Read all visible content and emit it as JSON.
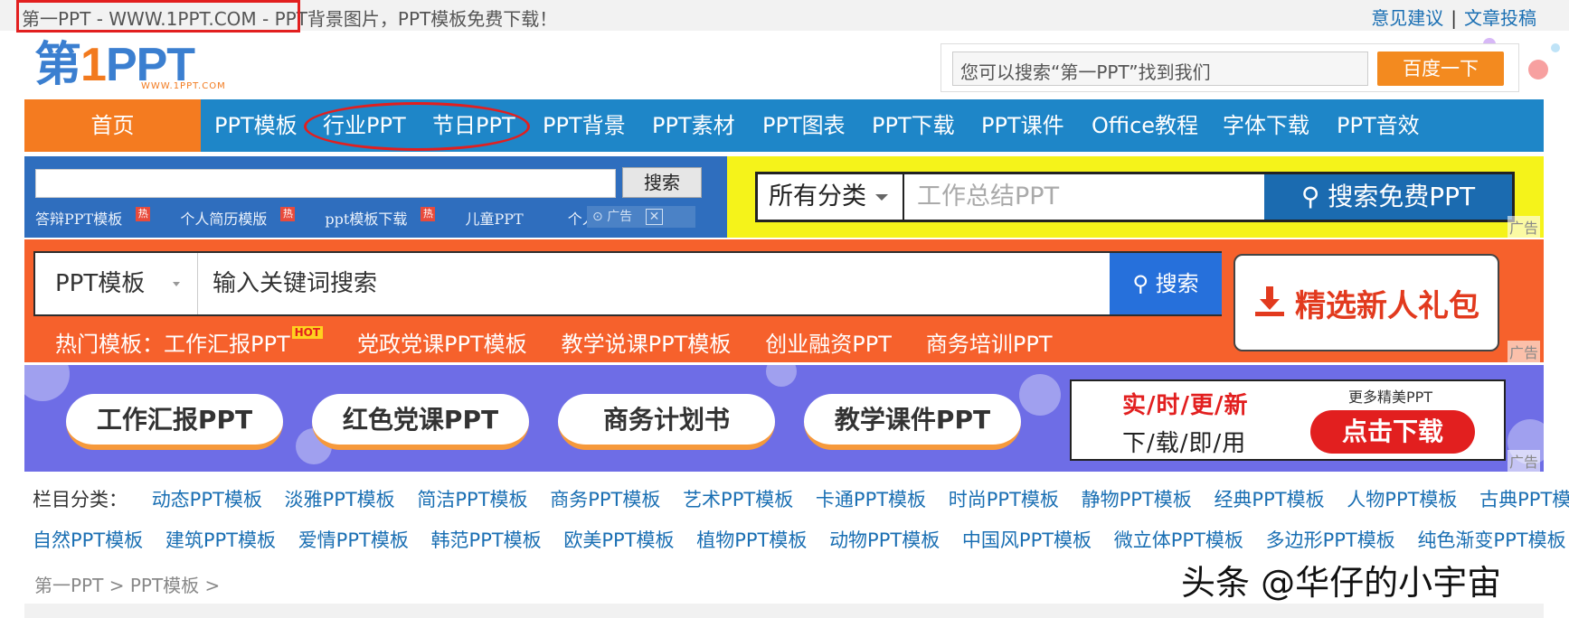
{
  "topbar": {
    "site_title": "第一PPT - WWW.1PPT.COM - PPT背景图片，PPT模板免费下载！",
    "link_feedback": "意见建议",
    "separator": "|",
    "link_submit": "文章投稿"
  },
  "logo": {
    "main_prefix": "第",
    "main_one": "1",
    "main_suffix": "PPT",
    "sub": "WWW.1PPT.COM"
  },
  "header_search": {
    "placeholder": "您可以搜索“第一PPT”找到我们",
    "button": "百度一下"
  },
  "nav": {
    "home": "首页",
    "items": [
      "PPT模板",
      "行业PPT",
      "节日PPT",
      "PPT背景",
      "PPT素材",
      "PPT图表",
      "PPT下载",
      "PPT课件",
      "Office教程",
      "字体下载",
      "PPT音效"
    ]
  },
  "ad_blue": {
    "button": "搜索",
    "links": [
      "答辩PPT模板",
      "个人简历模版",
      "ppt模板下载",
      "儿童PPT",
      "个人求职简历"
    ],
    "hot_marker": "热",
    "ad_mark": "广告",
    "close": "✕"
  },
  "ad_yellow": {
    "category": "所有分类",
    "placeholder": "工作总结PPT",
    "button": "搜索免费PPT",
    "ad_label": "广告"
  },
  "ad_orange": {
    "select": "PPT模板",
    "placeholder": "输入关键词搜索",
    "button": "搜索",
    "hot_prefix": "热门模板：",
    "hot_links": [
      "工作汇报PPT",
      "党政党课PPT模板",
      "教学说课PPT模板",
      "创业融资PPT",
      "商务培训PPT"
    ],
    "hot_badge": "HOT",
    "gift": "精选新人礼包",
    "ad_label": "广告"
  },
  "ad_purple": {
    "pills": [
      "工作汇报PPT",
      "红色党课PPT",
      "商务计划书",
      "教学课件PPT"
    ],
    "promo_line1": "实/时/更/新",
    "promo_line2": "下/载/即/用",
    "promo_more": "更多精美PPT",
    "promo_button": "点击下载",
    "ad_label": "广告"
  },
  "categories": {
    "label": "栏目分类：",
    "row1": [
      "动态PPT模板",
      "淡雅PPT模板",
      "简洁PPT模板",
      "商务PPT模板",
      "艺术PPT模板",
      "卡通PPT模板",
      "时尚PPT模板",
      "静物PPT模板",
      "经典PPT模板",
      "人物PPT模板",
      "古典PPT模板"
    ],
    "row2": [
      "自然PPT模板",
      "建筑PPT模板",
      "爱情PPT模板",
      "韩范PPT模板",
      "欧美PPT模板",
      "植物PPT模板",
      "动物PPT模板",
      "中国风PPT模板",
      "微立体PPT模板",
      "多边形PPT模板",
      "纯色渐变PPT模板"
    ]
  },
  "breadcrumb": {
    "home": "第一PPT",
    "sep": ">",
    "section": "PPT模板"
  },
  "watermark": "头条 @华仔的小宇宙",
  "colors": {
    "nav_blue": "#1e86c8",
    "home_orange": "#f47b20",
    "highlight_red": "#e21f1f",
    "link_blue": "#1a6fb3"
  }
}
